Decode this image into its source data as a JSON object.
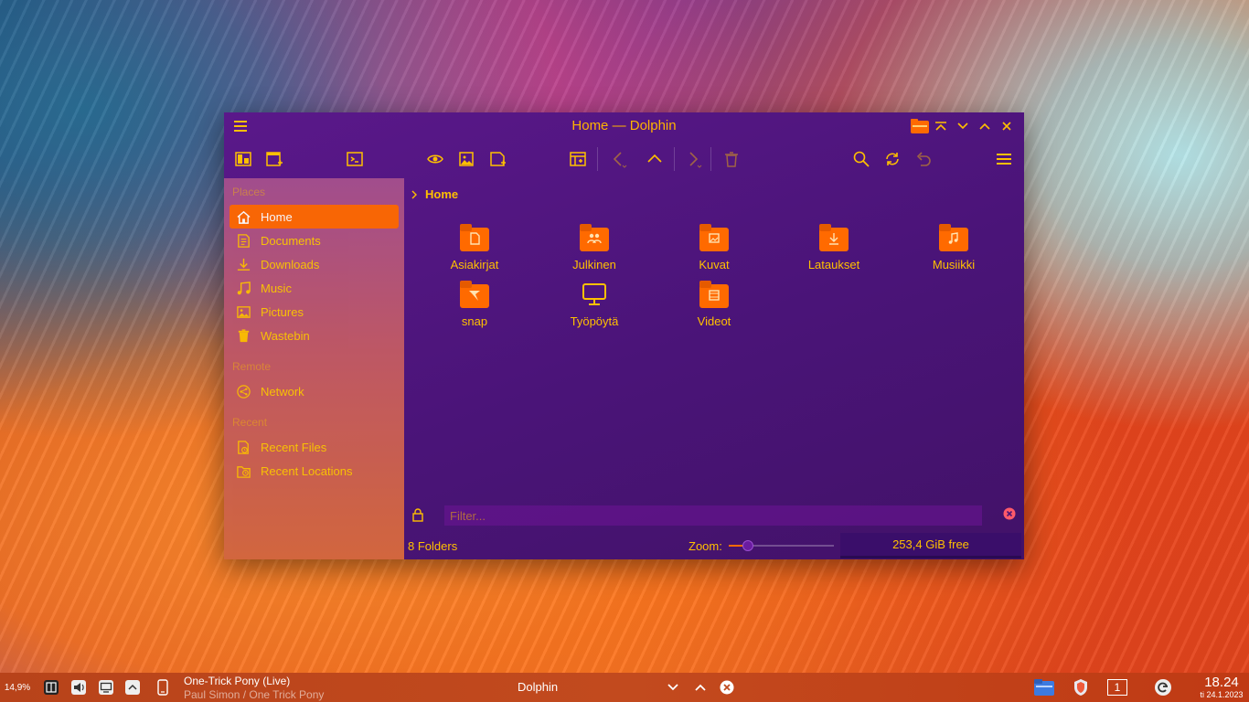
{
  "window": {
    "title": "Home — Dolphin",
    "colors": {
      "accent": "#ff6a00",
      "text": "#ffc000",
      "bg": "#4a1478"
    }
  },
  "sidebar": {
    "sections": {
      "places": "Places",
      "remote": "Remote",
      "recent": "Recent"
    },
    "places": [
      {
        "label": "Home",
        "icon": "home-icon",
        "active": true
      },
      {
        "label": "Documents",
        "icon": "documents-icon"
      },
      {
        "label": "Downloads",
        "icon": "downloads-icon"
      },
      {
        "label": "Music",
        "icon": "music-icon"
      },
      {
        "label": "Pictures",
        "icon": "pictures-icon"
      },
      {
        "label": "Wastebin",
        "icon": "wastebin-icon"
      }
    ],
    "remote": [
      {
        "label": "Network",
        "icon": "network-icon"
      }
    ],
    "recent": [
      {
        "label": "Recent Files",
        "icon": "recent-files-icon"
      },
      {
        "label": "Recent Locations",
        "icon": "recent-locations-icon"
      }
    ]
  },
  "breadcrumb": {
    "current": "Home"
  },
  "items": [
    {
      "name": "Asiakirjat",
      "icon": "folder-documents-icon"
    },
    {
      "name": "Julkinen",
      "icon": "folder-public-icon"
    },
    {
      "name": "Kuvat",
      "icon": "folder-pictures-icon"
    },
    {
      "name": "Lataukset",
      "icon": "folder-download-icon"
    },
    {
      "name": "Musiikki",
      "icon": "folder-music-icon"
    },
    {
      "name": "snap",
      "icon": "folder-snap-icon"
    },
    {
      "name": "Työpöytä",
      "icon": "desktop-icon"
    },
    {
      "name": "Videot",
      "icon": "folder-videos-icon"
    }
  ],
  "filter": {
    "placeholder": "Filter..."
  },
  "status": {
    "count": "8 Folders",
    "zoom_label": "Zoom:",
    "zoom_level": 0.18,
    "free": "253,4 GiB free"
  },
  "taskbar": {
    "cpu": "14,9%",
    "media": {
      "title": "One-Trick Pony (Live)",
      "subtitle": "Paul Simon / One Trick Pony"
    },
    "task": "Dolphin",
    "desktop_number": "1",
    "clock": {
      "time": "18.24",
      "date": "ti 24.1.2023"
    }
  }
}
